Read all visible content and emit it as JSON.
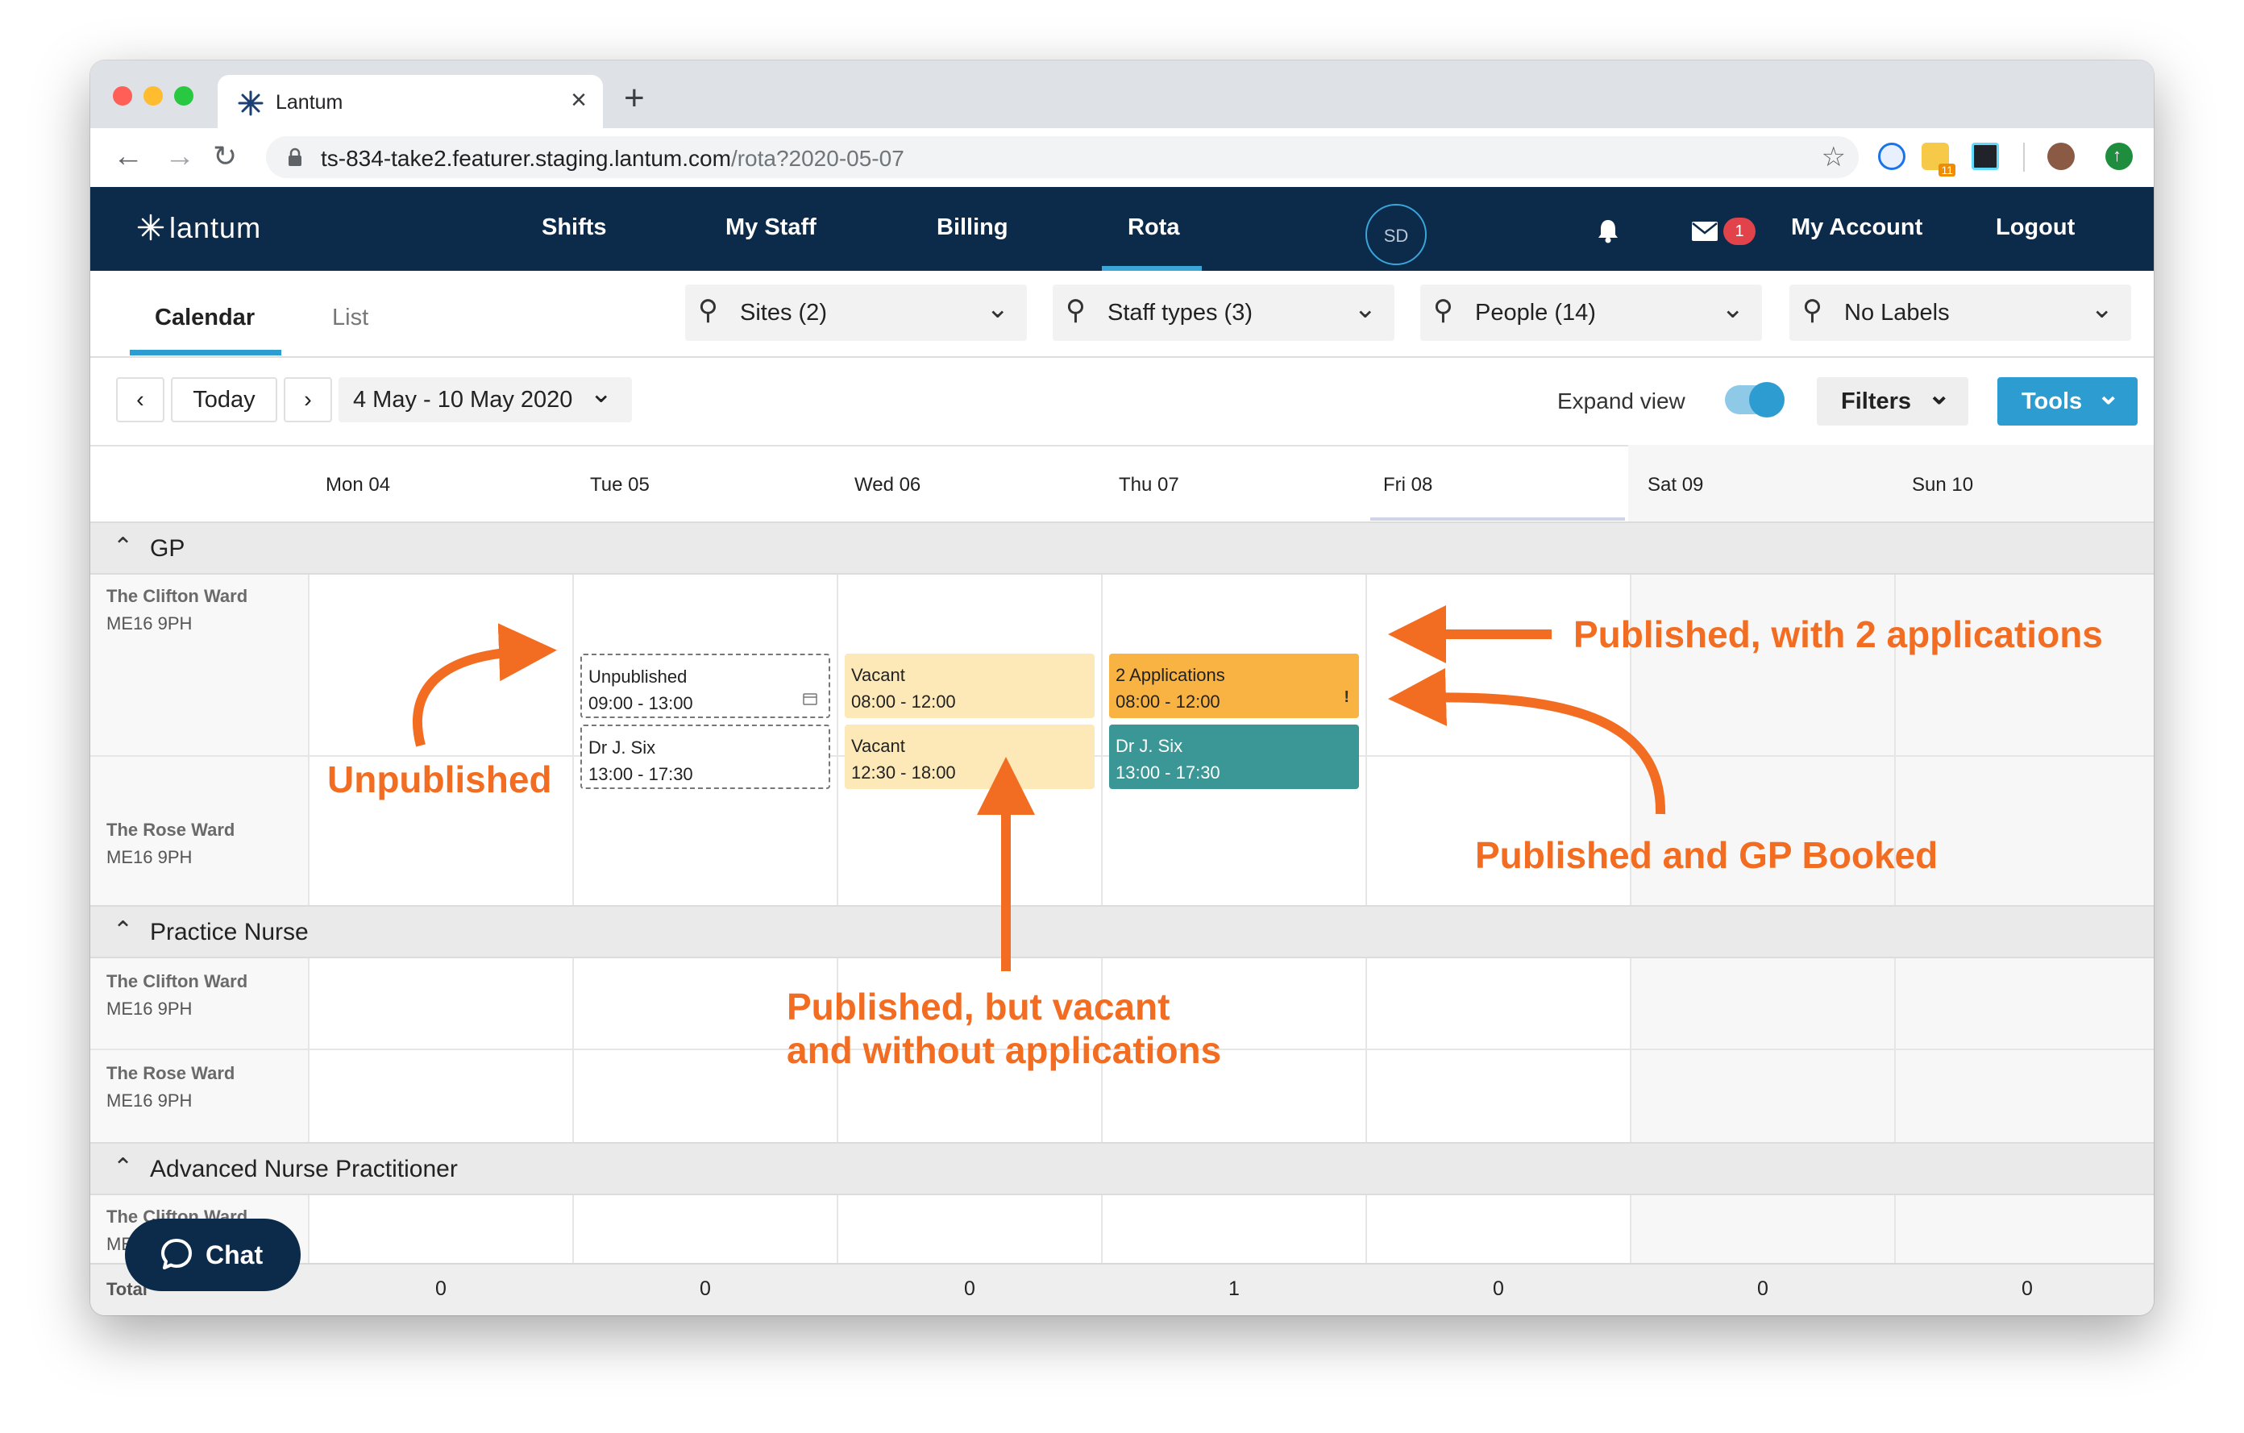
{
  "browser": {
    "tab_title": "Lantum",
    "url_main": "ts-834-take2.featurer.staging.lantum.com",
    "url_path": "/rota?2020-05-07",
    "ext_badge": "11"
  },
  "app": {
    "logo": "lantum",
    "nav": [
      "Shifts",
      "My Staff",
      "Billing",
      "Rota"
    ],
    "avatar_initials": "SD",
    "message_count": "1",
    "my_account": "My Account",
    "logout": "Logout"
  },
  "subnav": {
    "tabs": [
      "Calendar",
      "List"
    ],
    "dropdowns": [
      "Sites (2)",
      "Staff types (3)",
      "People (14)",
      "No Labels"
    ]
  },
  "controls": {
    "today": "Today",
    "date_range": "4 May - 10 May 2020",
    "expand_view": "Expand view",
    "filters": "Filters",
    "tools": "Tools"
  },
  "days": [
    "Mon 04",
    "Tue 05",
    "Wed 06",
    "Thu 07",
    "Fri 08",
    "Sat 09",
    "Sun 10"
  ],
  "groups": [
    {
      "title": "GP",
      "rows": [
        {
          "name": "The Clifton Ward",
          "postcode": "ME16 9PH"
        },
        {
          "name": "The Rose Ward",
          "postcode": "ME16 9PH"
        }
      ]
    },
    {
      "title": "Practice Nurse",
      "rows": [
        {
          "name": "The Clifton Ward",
          "postcode": "ME16 9PH"
        },
        {
          "name": "The Rose Ward",
          "postcode": "ME16 9PH"
        }
      ]
    },
    {
      "title": "Advanced Nurse Practitioner",
      "rows": [
        {
          "name": "The Clifton Ward",
          "postcode": "ME16 9PH"
        }
      ]
    }
  ],
  "shifts": [
    {
      "status": "Unpublished",
      "time": "09:00 - 13:00"
    },
    {
      "status": "Dr J. Six",
      "time": "13:00 - 17:30"
    },
    {
      "status": "Vacant",
      "time": "08:00 - 12:00"
    },
    {
      "status": "Vacant",
      "time": "12:30 - 18:00"
    },
    {
      "status": "2 Applications",
      "time": "08:00 - 12:00",
      "mark": "!"
    },
    {
      "status": "Dr J. Six",
      "time": "13:00 - 17:30"
    }
  ],
  "totals": {
    "label": "Total",
    "values": [
      "0",
      "0",
      "0",
      "1",
      "0",
      "0",
      "0"
    ]
  },
  "chat": "Chat",
  "annotations": {
    "published_apps": "Published, with 2 applications",
    "unpublished": "Unpublished",
    "booked": "Published and GP Booked",
    "vacant_line1": "Published, but vacant",
    "vacant_line2": "and without applications"
  },
  "colors": {
    "nav_bg": "#0c2a4a",
    "accent": "#2d9cd1",
    "vacant": "#fde9b8",
    "applications": "#f8b342",
    "booked": "#3b9796",
    "annotation": "#f26d22"
  }
}
